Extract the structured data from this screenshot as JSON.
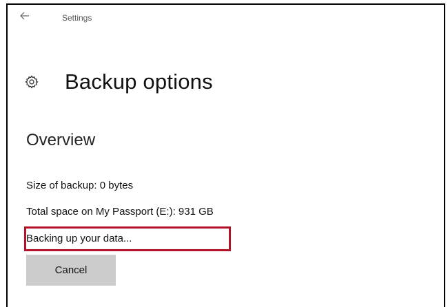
{
  "titlebar": {
    "back_icon": "arrow-left-icon",
    "app_title": "Settings"
  },
  "header": {
    "icon": "gear-icon",
    "title": "Backup options"
  },
  "overview": {
    "section_title": "Overview",
    "backup_size": "Size of backup: 0 bytes",
    "total_space": "Total space on My Passport (E:): 931 GB",
    "status": "Backing up your data...",
    "cancel_label": "Cancel"
  },
  "colors": {
    "highlight_border": "#b5122a",
    "button_bg": "#cccccc"
  }
}
